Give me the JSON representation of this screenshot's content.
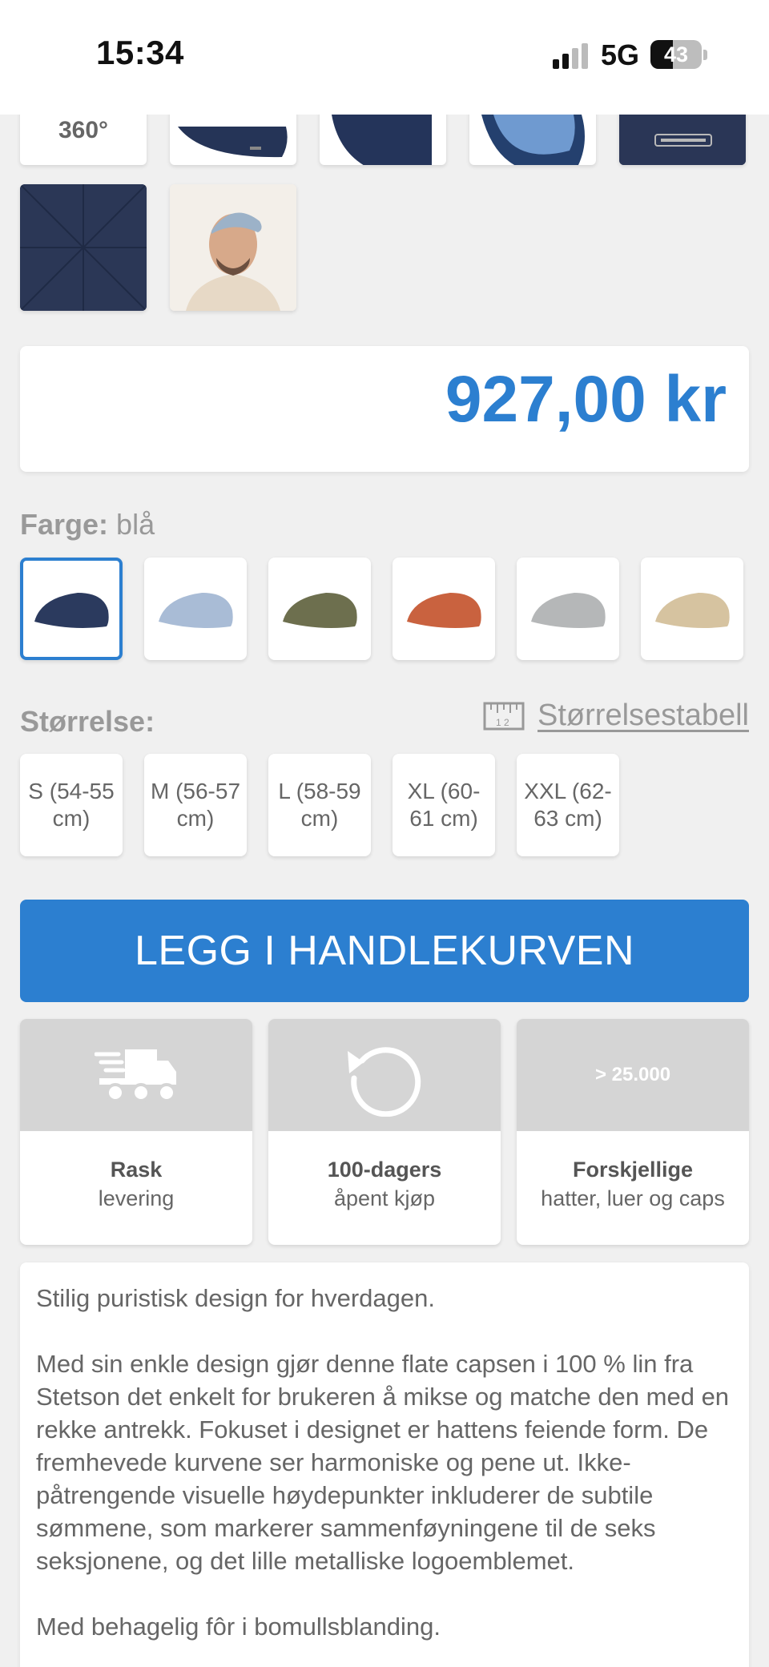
{
  "status_bar": {
    "time": "15:34",
    "network": "5G",
    "battery": "43"
  },
  "gallery": {
    "view_360_label": "360°",
    "thumbnails": [
      "cap-side-navy",
      "cap-top-navy",
      "cap-underside-blue",
      "logo-detail",
      "fabric-closeup",
      "model-wearing-cap"
    ]
  },
  "price": "927,00 kr",
  "color": {
    "label": "Farge:",
    "selected_value": "blå",
    "swatches": [
      {
        "name": "navy",
        "hex": "#2b3a5e"
      },
      {
        "name": "light-blue",
        "hex": "#a9bcd6"
      },
      {
        "name": "olive",
        "hex": "#6d6f4e"
      },
      {
        "name": "rust",
        "hex": "#c9623f"
      },
      {
        "name": "light-grey",
        "hex": "#b5b7b8"
      },
      {
        "name": "beige",
        "hex": "#d6c3a0"
      }
    ]
  },
  "size": {
    "label": "Størrelse:",
    "table_link": "Størrelsestabell",
    "options": [
      "S (54-55 cm)",
      "M (56-57 cm)",
      "L (58-59 cm)",
      "XL (60-61 cm)",
      "XXL (62-63 cm)"
    ]
  },
  "cta_label": "LEGG I HANDLEKURVEN",
  "features": [
    {
      "icon": "fast-delivery-truck-icon",
      "title": "Rask",
      "subtitle": "levering"
    },
    {
      "icon": "return-arrow-icon",
      "title": "100-dagers",
      "subtitle": "åpent kjøp"
    },
    {
      "icon_text": "> 25.000",
      "title": "Forskjellige",
      "subtitle": "hatter, luer og caps"
    }
  ],
  "description": {
    "intro": "Stilig puristisk design for hverdagen.",
    "body": "Med sin enkle design gjør denne flate capsen i 100 % lin fra Stetson det enkelt for brukeren å mikse og matche den med en rekke antrekk. Fokuset i designet er hattens feiende form. De fremhevede kurvene ser harmoniske og pene ut. Ikke-påtrengende visuelle høydepunkter inkluderer de subtile sømmene, som markerer sammenføyningene til de seks seksjonene, og det lille metalliske logoemblemet.",
    "cut_off": "Med behagelig fôr i bomullsblanding."
  },
  "accent_color": "#2c7fd0"
}
